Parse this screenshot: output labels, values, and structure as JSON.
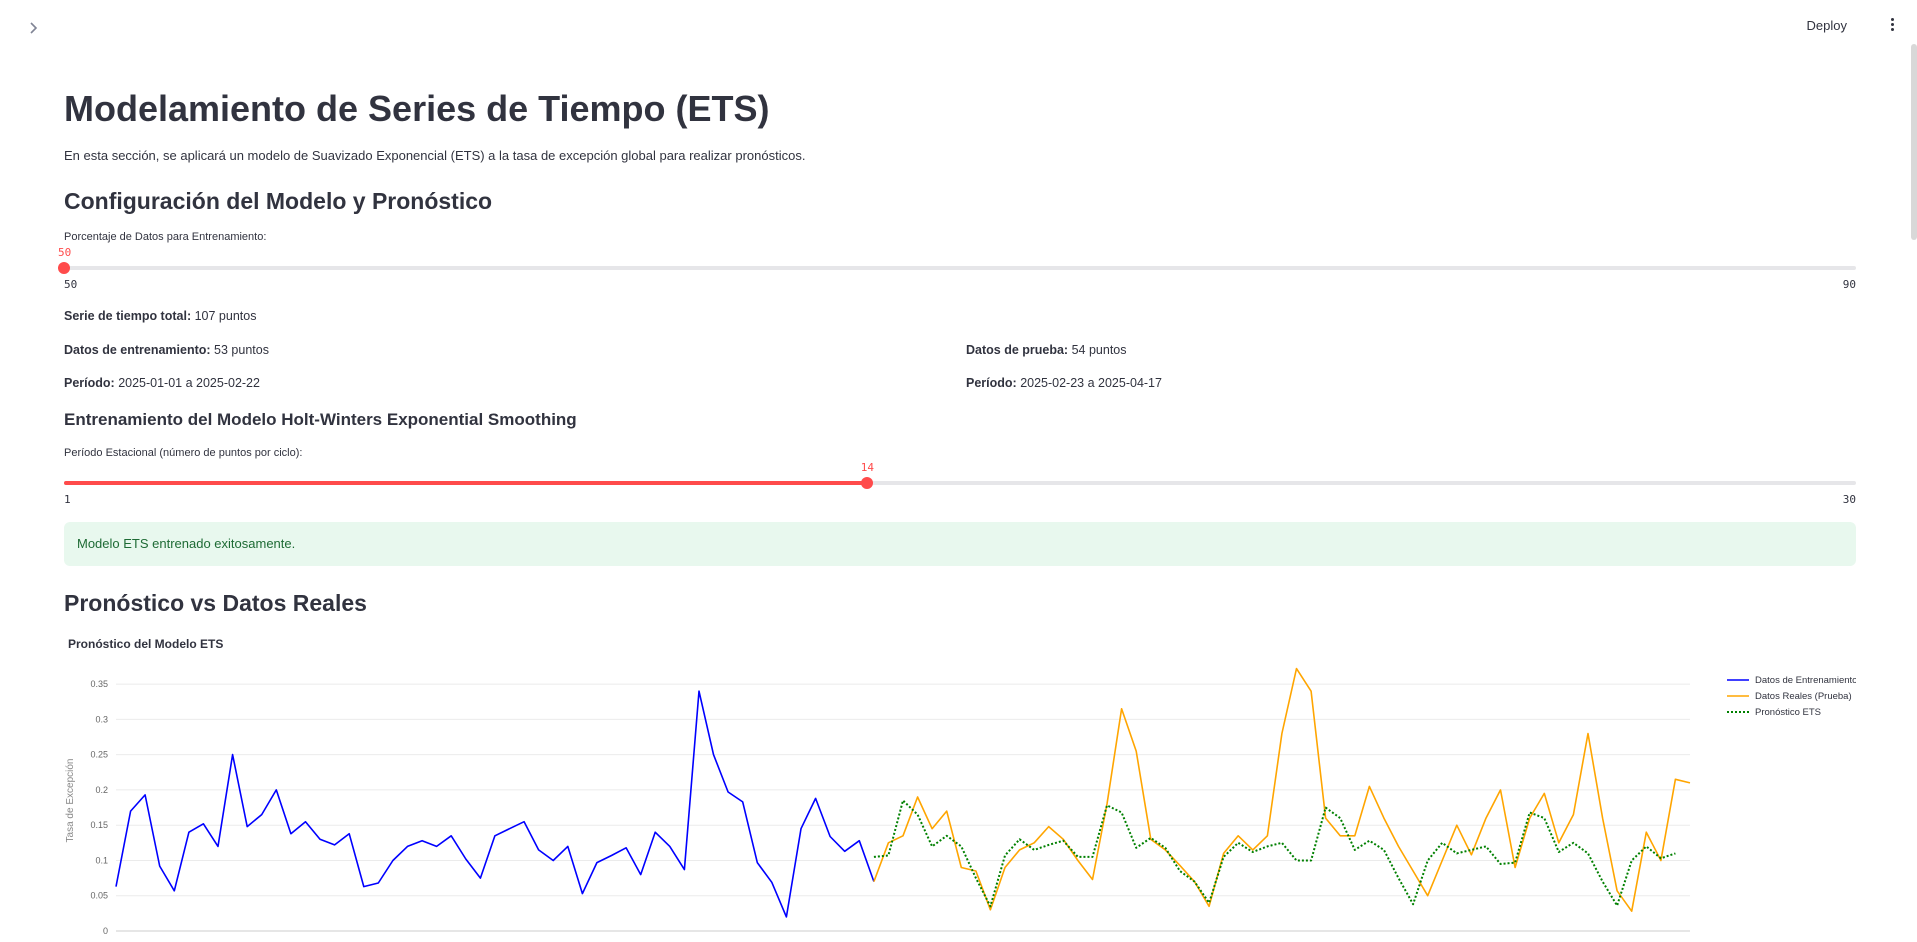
{
  "header": {
    "sidebar_toggle_icon": "chevron-right-icon",
    "deploy_label": "Deploy",
    "menu_icon": "kebab-menu-icon"
  },
  "page": {
    "title": "Modelamiento de Series de Tiempo (ETS)",
    "intro": "En esta sección, se aplicará un modelo de Suavizado Exponencial (ETS) a la tasa de excepción global para realizar pronósticos."
  },
  "config": {
    "heading": "Configuración del Modelo y Pronóstico",
    "train_slider": {
      "label": "Porcentaje de Datos para Entrenamiento:",
      "value": 50,
      "min": 50,
      "max": 90
    },
    "total_label": "Serie de tiempo total:",
    "total_value": "107 puntos",
    "train_label": "Datos de entrenamiento:",
    "train_value": "53 puntos",
    "test_label": "Datos de prueba:",
    "test_value": "54 puntos",
    "train_period_label": "Período:",
    "train_period_value": "2025-01-01 a 2025-02-22",
    "test_period_label": "Período:",
    "test_period_value": "2025-02-23 a 2025-04-17"
  },
  "training": {
    "heading": "Entrenamiento del Modelo Holt-Winters Exponential Smoothing",
    "season_slider": {
      "label": "Período Estacional (número de puntos por ciclo):",
      "value": 14,
      "min": 1,
      "max": 30
    },
    "success_message": "Modelo ETS entrenado exitosamente."
  },
  "forecast": {
    "heading": "Pronóstico vs Datos Reales"
  },
  "colors": {
    "accent": "#ff4b4b",
    "train": "#0000ff",
    "test": "#ffa500",
    "forecast": "#008000"
  },
  "chart_data": {
    "type": "line",
    "title": "Pronóstico del Modelo ETS",
    "ylabel": "Tasa de Excepción",
    "ylim": [
      0,
      0.37
    ],
    "yticks": [
      0,
      0.05,
      0.1,
      0.15,
      0.2,
      0.25,
      0.3,
      0.35
    ],
    "ytick_labels": [
      "0",
      "0.05",
      "0.1",
      "0.15",
      "0.2",
      "0.25",
      "0.3",
      "0.35"
    ],
    "grid": true,
    "legend_position": "top-right",
    "series": [
      {
        "name": "Datos de Entrenamiento",
        "start_index": 0,
        "style": "solid",
        "color": "#0000ff",
        "values": [
          0.063,
          0.17,
          0.193,
          0.092,
          0.057,
          0.14,
          0.152,
          0.12,
          0.25,
          0.148,
          0.165,
          0.2,
          0.138,
          0.155,
          0.13,
          0.122,
          0.138,
          0.063,
          0.068,
          0.1,
          0.12,
          0.128,
          0.12,
          0.135,
          0.102,
          0.075,
          0.135,
          0.145,
          0.155,
          0.115,
          0.1,
          0.12,
          0.053,
          0.097,
          0.107,
          0.118,
          0.08,
          0.14,
          0.12,
          0.087,
          0.34,
          0.25,
          0.197,
          0.183,
          0.097,
          0.069,
          0.02,
          0.145,
          0.188,
          0.134,
          0.113,
          0.128,
          0.07
        ]
      },
      {
        "name": "Datos Reales (Prueba)",
        "start_index": 52,
        "style": "solid",
        "color": "#ffa500",
        "values": [
          0.07,
          0.125,
          0.135,
          0.19,
          0.145,
          0.17,
          0.09,
          0.085,
          0.03,
          0.09,
          0.115,
          0.125,
          0.148,
          0.13,
          0.1,
          0.073,
          0.18,
          0.315,
          0.255,
          0.13,
          0.115,
          0.093,
          0.07,
          0.035,
          0.11,
          0.135,
          0.115,
          0.135,
          0.28,
          0.372,
          0.34,
          0.16,
          0.135,
          0.135,
          0.205,
          0.16,
          0.12,
          0.085,
          0.05,
          0.1,
          0.15,
          0.108,
          0.16,
          0.2,
          0.09,
          0.16,
          0.195,
          0.125,
          0.165,
          0.28,
          0.16,
          0.057,
          0.028,
          0.14,
          0.1,
          0.215,
          0.21
        ]
      },
      {
        "name": "Pronóstico ETS",
        "start_index": 52,
        "style": "dotted",
        "color": "#008000",
        "values": [
          0.105,
          0.107,
          0.185,
          0.165,
          0.12,
          0.135,
          0.12,
          0.075,
          0.035,
          0.107,
          0.13,
          0.115,
          0.122,
          0.128,
          0.105,
          0.105,
          0.178,
          0.168,
          0.118,
          0.132,
          0.118,
          0.085,
          0.07,
          0.04,
          0.105,
          0.125,
          0.112,
          0.12,
          0.125,
          0.1,
          0.1,
          0.175,
          0.16,
          0.115,
          0.128,
          0.115,
          0.075,
          0.038,
          0.1,
          0.125,
          0.11,
          0.115,
          0.12,
          0.095,
          0.097,
          0.168,
          0.16,
          0.112,
          0.125,
          0.11,
          0.07,
          0.036,
          0.1,
          0.12,
          0.103,
          0.11
        ]
      }
    ]
  }
}
